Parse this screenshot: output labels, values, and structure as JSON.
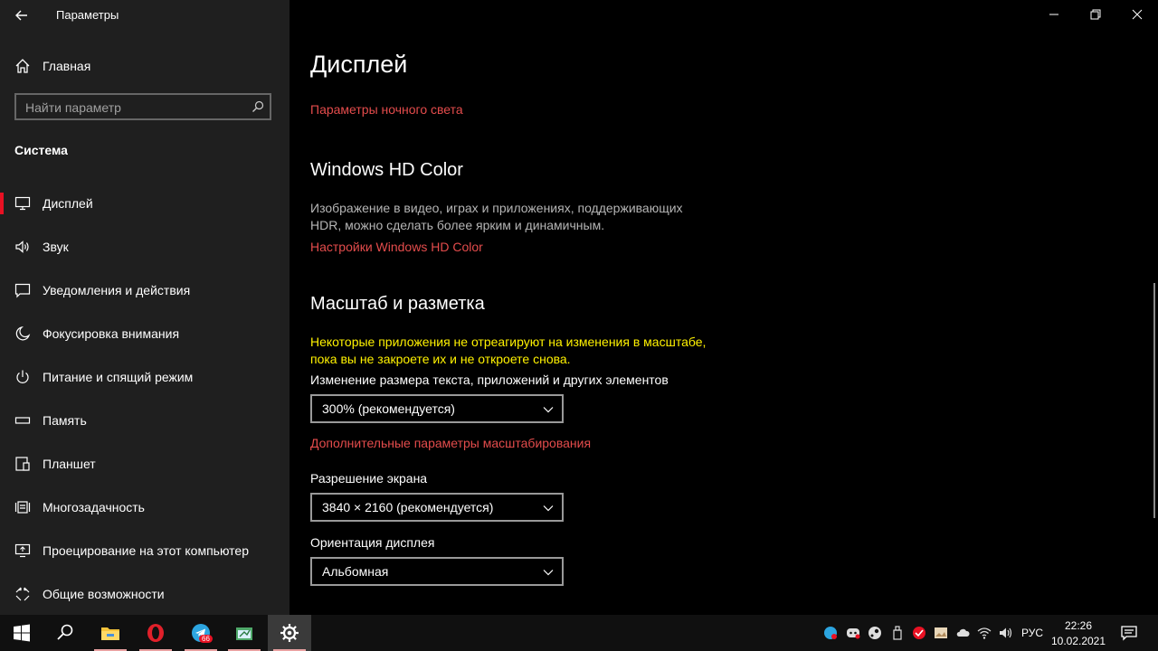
{
  "window": {
    "title": "Параметры"
  },
  "sidebar": {
    "home_label": "Главная",
    "search_placeholder": "Найти параметр",
    "section_title": "Система",
    "items": [
      {
        "label": "Дисплей",
        "icon": "monitor-icon",
        "active": true
      },
      {
        "label": "Звук",
        "icon": "speaker-icon"
      },
      {
        "label": "Уведомления и действия",
        "icon": "notification-icon"
      },
      {
        "label": "Фокусировка внимания",
        "icon": "moon-icon"
      },
      {
        "label": "Питание и спящий режим",
        "icon": "power-icon"
      },
      {
        "label": "Память",
        "icon": "storage-icon"
      },
      {
        "label": "Планшет",
        "icon": "tablet-icon"
      },
      {
        "label": "Многозадачность",
        "icon": "multitasking-icon"
      },
      {
        "label": "Проецирование на этот компьютер",
        "icon": "projecting-icon"
      },
      {
        "label": "Общие возможности",
        "icon": "shared-experiences-icon"
      }
    ]
  },
  "main": {
    "title": "Дисплей",
    "night_light_link": "Параметры ночного света",
    "hdr": {
      "title": "Windows HD Color",
      "description": "Изображение в видео, играх и приложениях, поддерживающих HDR, можно сделать более ярким и динамичным.",
      "link": "Настройки Windows HD Color"
    },
    "scale": {
      "title": "Масштаб и разметка",
      "warning": "Некоторые приложения не отреагируют на изменения в масштабе, пока вы не закроете их и не откроете снова.",
      "size_label": "Изменение размера текста, приложений и других элементов",
      "size_value": "300% (рекомендуется)",
      "advanced_link": "Дополнительные параметры масштабирования",
      "resolution_label": "Разрешение экрана",
      "resolution_value": "3840 × 2160 (рекомендуется)",
      "orientation_label": "Ориентация дисплея",
      "orientation_value": "Альбомная"
    }
  },
  "taskbar": {
    "apps": [
      "start-icon",
      "search-icon",
      "file-explorer-icon",
      "opera-icon",
      "telegram-icon",
      "app-icon",
      "settings-gear-icon"
    ],
    "telegram_badge": "66",
    "lang": "РУС",
    "time": "22:26",
    "date": "10.02.2021"
  },
  "colors": {
    "accent": "#e81123",
    "link": "#e44c4c",
    "warning": "#fff200",
    "sidebar_bg": "#1f1f1f"
  }
}
